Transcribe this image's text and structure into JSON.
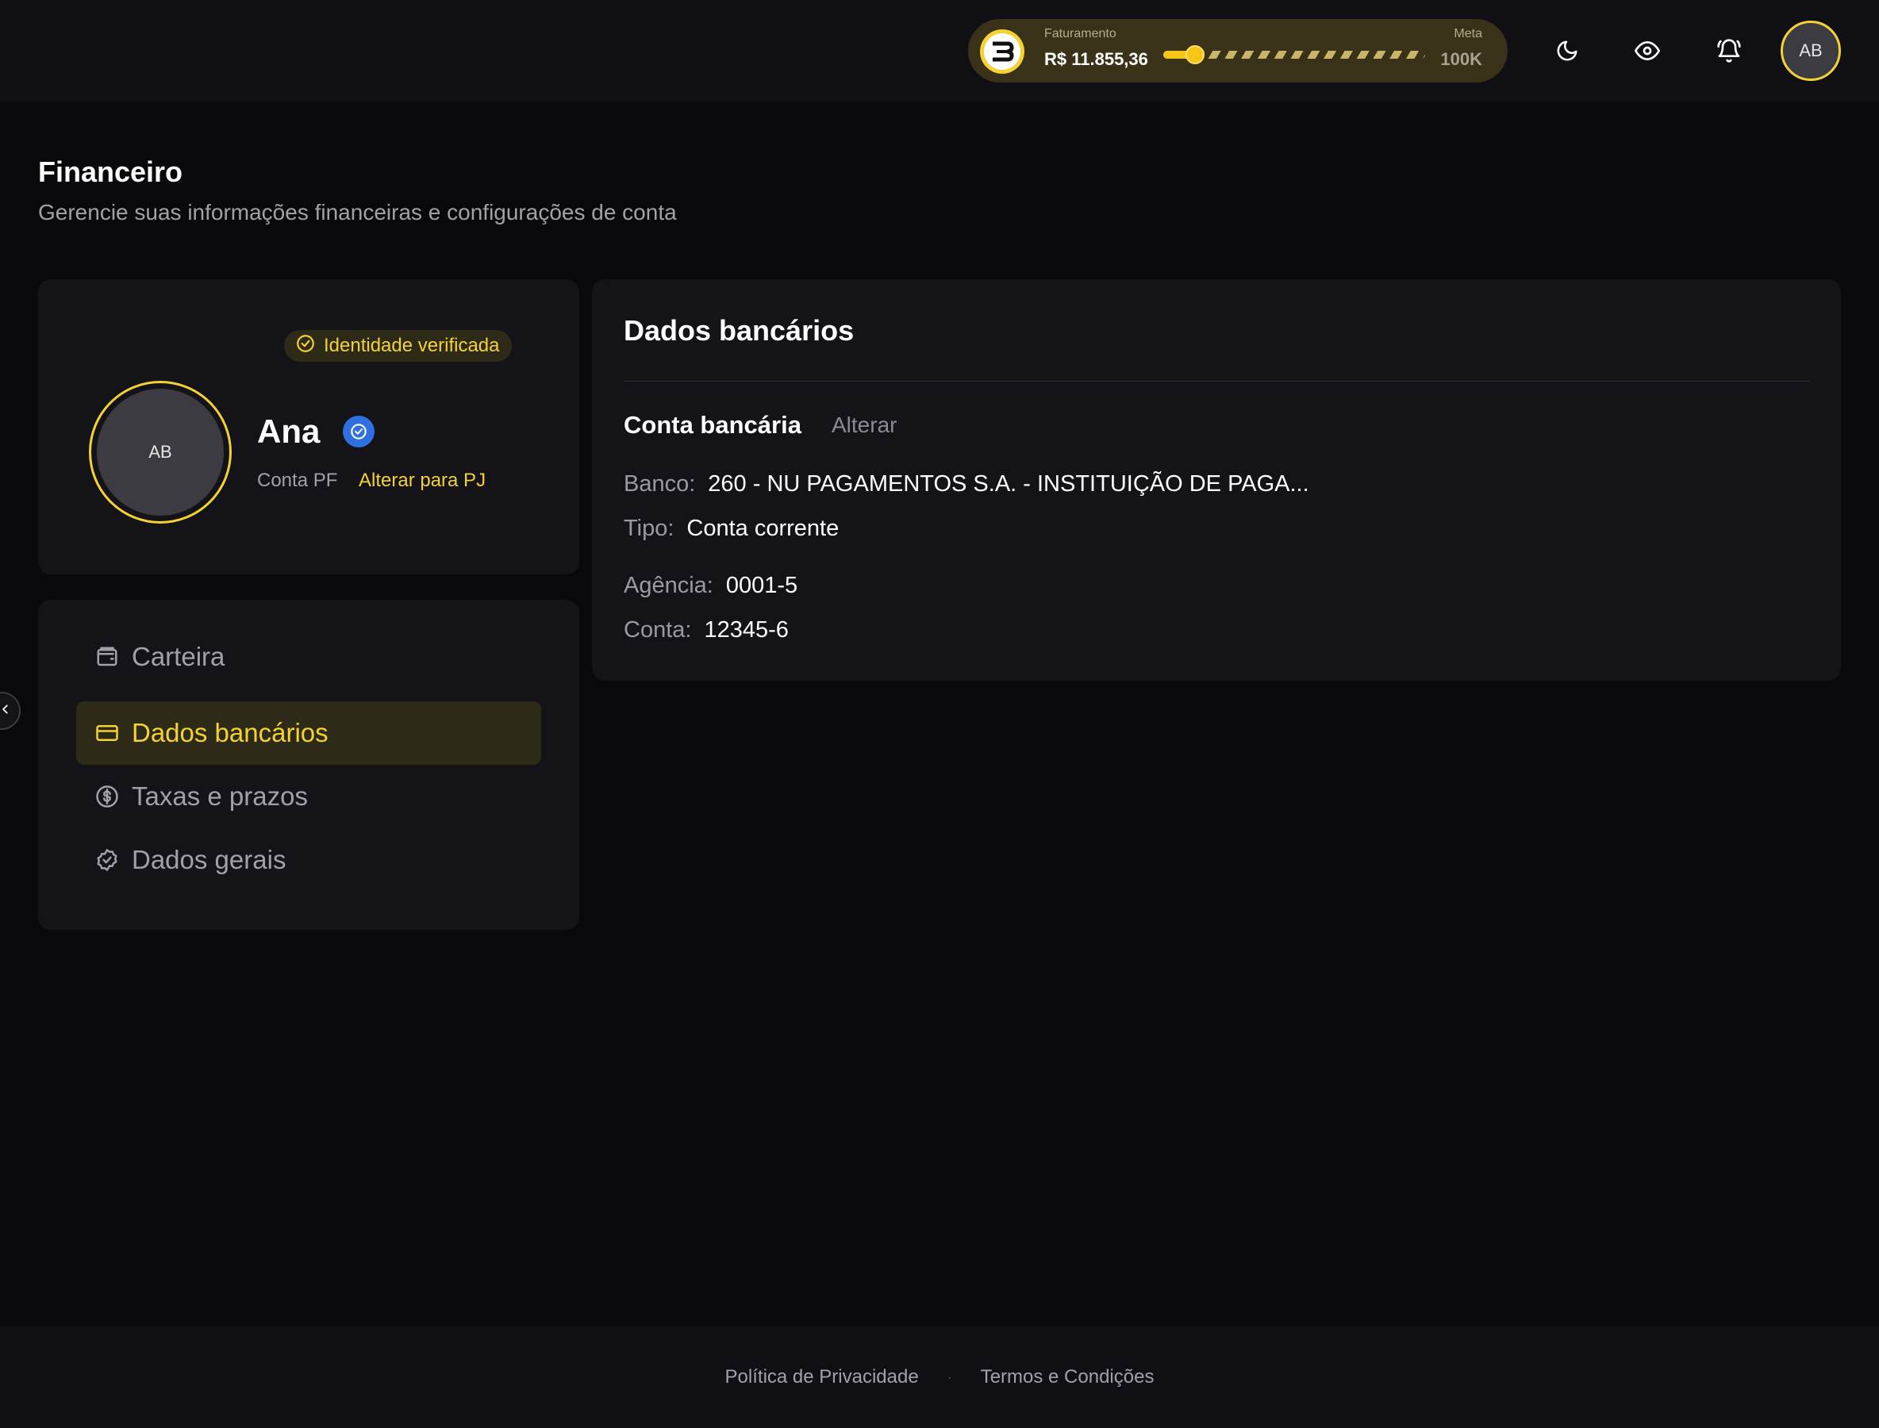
{
  "header": {
    "revenue": {
      "label": "Faturamento",
      "value": "R$ 11.855,36",
      "goal_label": "Meta",
      "goal_value": "100K",
      "progress_fraction": 0.12
    },
    "icons": [
      "moon-icon",
      "eye-icon",
      "bell-icon"
    ],
    "avatar_initials": "AB"
  },
  "page": {
    "title": "Financeiro",
    "subtitle": "Gerencie suas informações financeiras e configurações de conta"
  },
  "profile": {
    "badge": "Identidade verificada",
    "avatar_initials": "AB",
    "name": "Ana",
    "account_type": "Conta PF",
    "switch_link": "Alterar para PJ"
  },
  "nav": {
    "items": [
      {
        "label": "Carteira",
        "icon": "wallet-icon"
      },
      {
        "label": "Dados bancários",
        "icon": "credit-card-icon",
        "active": true
      },
      {
        "label": "Taxas e prazos",
        "icon": "dollar-circle-icon"
      },
      {
        "label": "Dados gerais",
        "icon": "badge-check-icon"
      }
    ]
  },
  "bank": {
    "title": "Dados bancários",
    "account_heading": "Conta bancária",
    "change_link": "Alterar",
    "fields": {
      "bank": {
        "label": "Banco:",
        "value": "260 - NU PAGAMENTOS S.A. - INSTITUIÇÃO DE PAGA..."
      },
      "type": {
        "label": "Tipo:",
        "value": "Conta corrente"
      },
      "agency": {
        "label": "Agência:",
        "value": "0001-5"
      },
      "account": {
        "label": "Conta:",
        "value": "12345-6"
      }
    }
  },
  "footer": {
    "privacy": "Política de Privacidade",
    "separator": "·",
    "terms": "Termos e Condições"
  },
  "colors": {
    "accent": "#f5d233",
    "background": "#09090b",
    "card": "#131318",
    "verified_blue": "#2f6fe0"
  }
}
